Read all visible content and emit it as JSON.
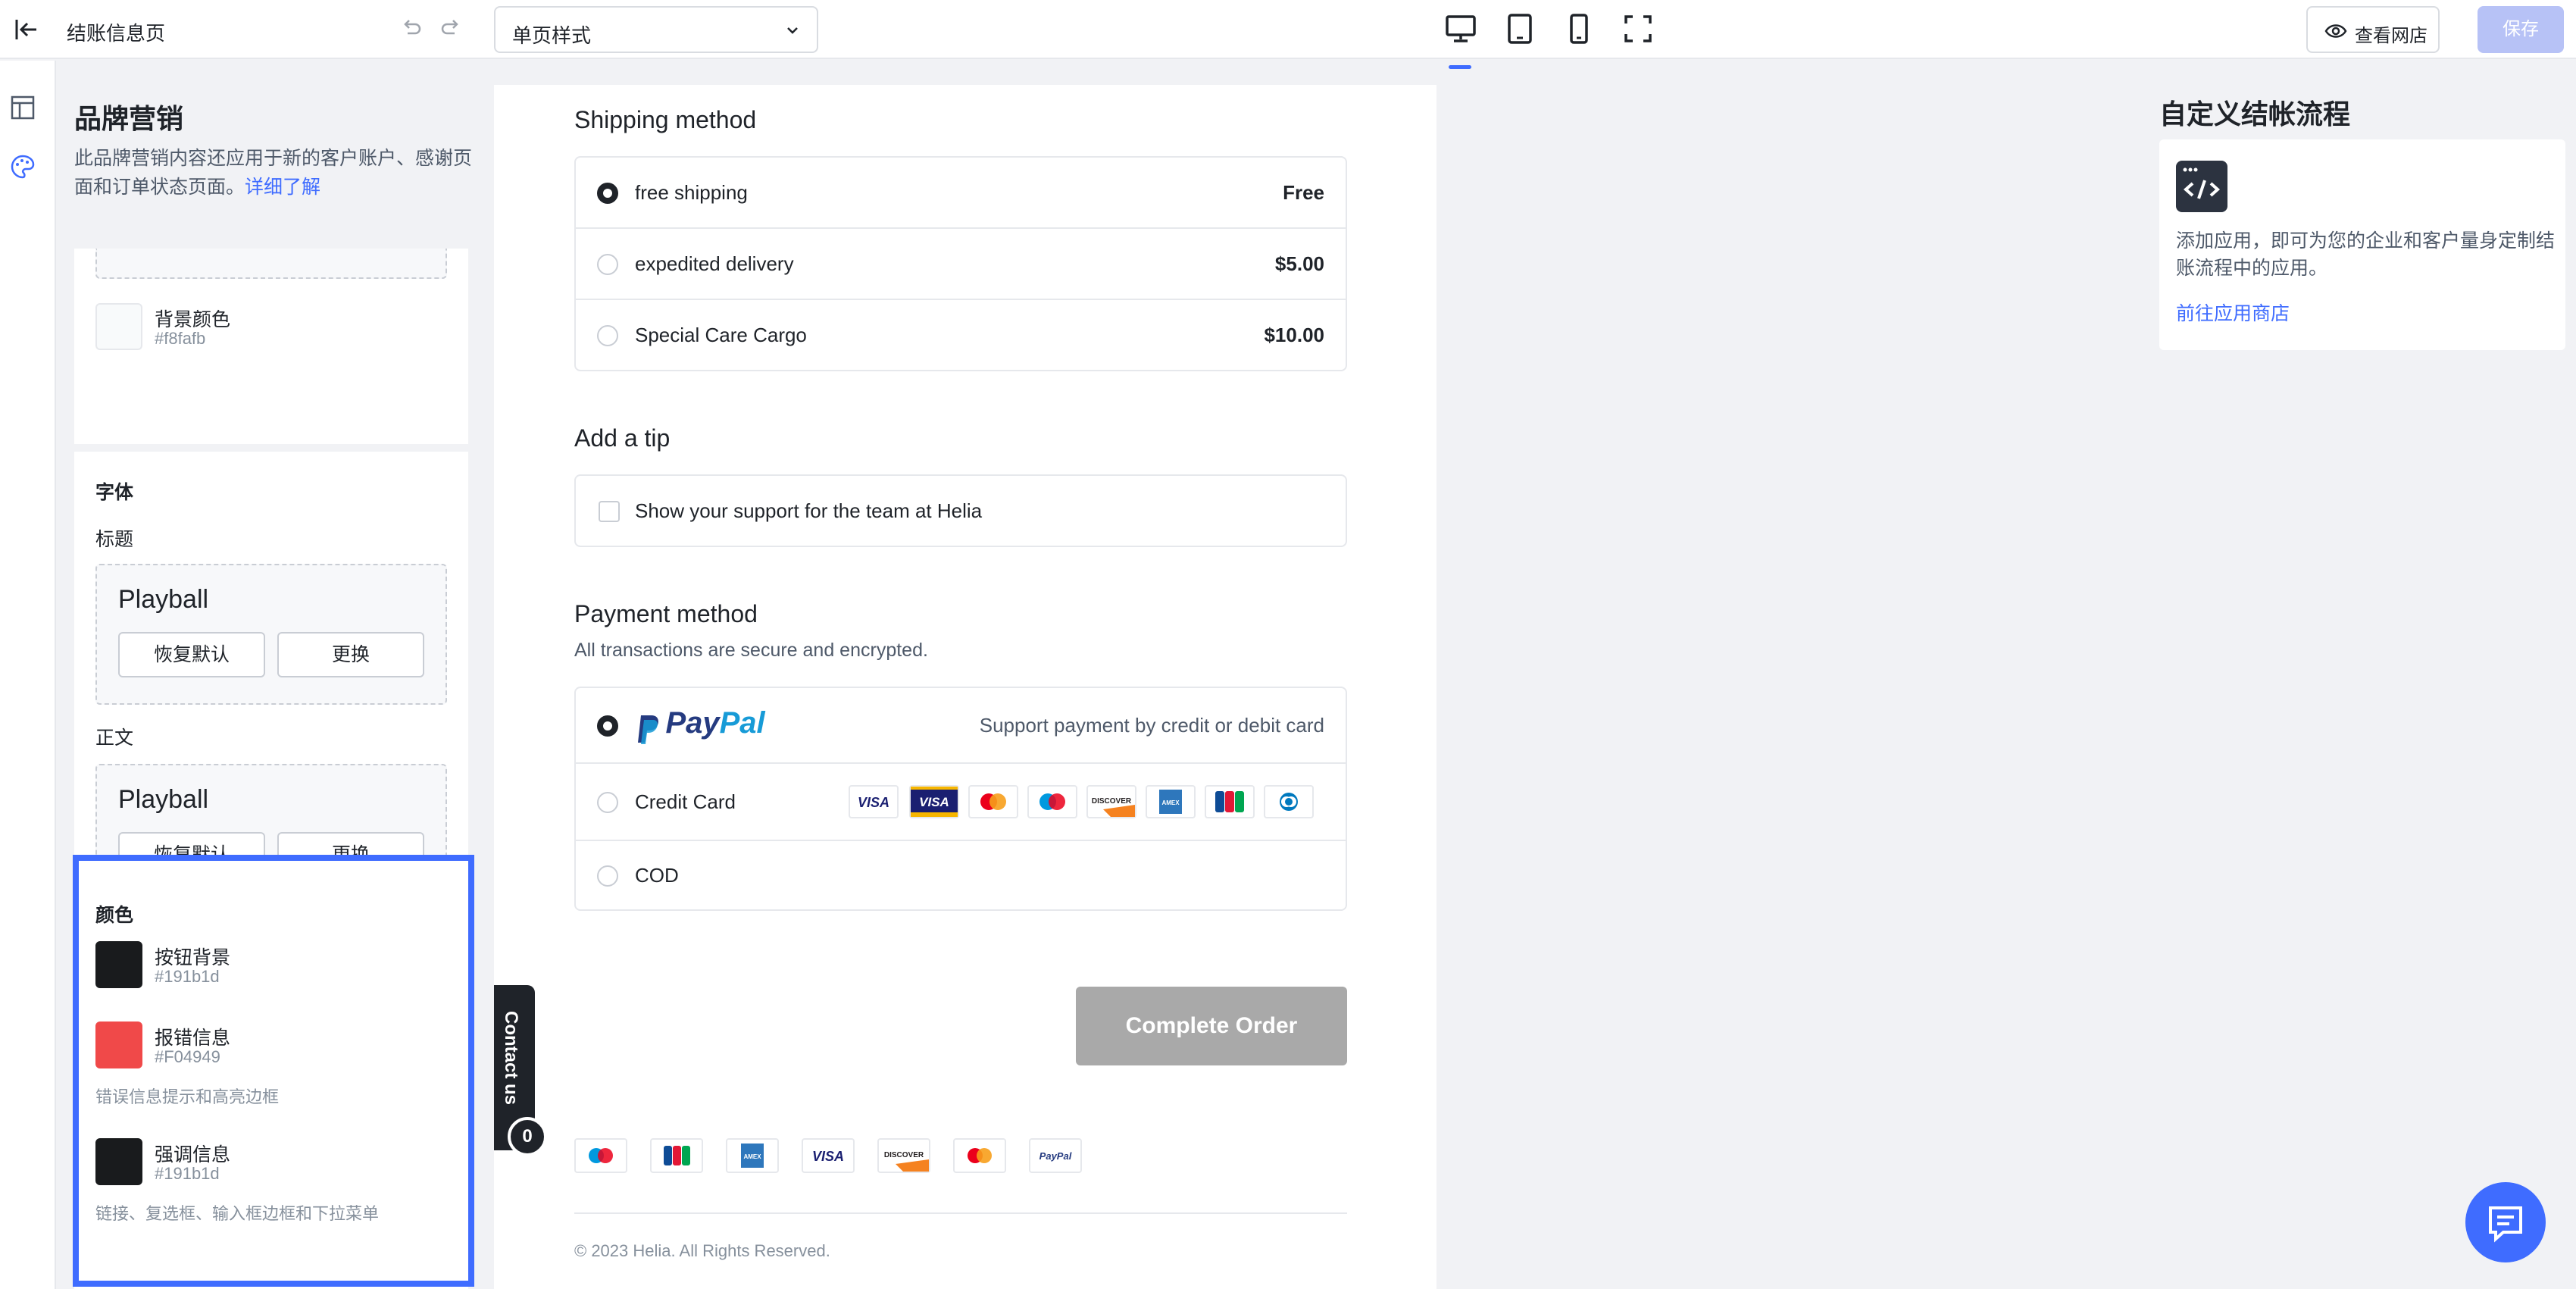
{
  "topbar": {
    "title": "结账信息页",
    "page_style": "单页样式",
    "view_store": "查看网店",
    "save": "保存"
  },
  "brand_panel": {
    "heading": "品牌营销",
    "description": "此品牌营销内容还应用于新的客户账户、感谢页面和订单状态页面。",
    "learn_more": "详细了解",
    "background": {
      "name": "背景颜色",
      "hex": "#f8fafb",
      "color": "#f8fafb"
    },
    "fonts": {
      "section": "字体",
      "heading_label": "标题",
      "heading_font": "Playball",
      "body_label": "正文",
      "body_font": "Playball",
      "reset": "恢复默认",
      "change": "更换"
    },
    "colors": {
      "section": "颜色",
      "items": [
        {
          "name": "按钮背景",
          "hex": "#191b1d",
          "color": "#191b1d",
          "note": ""
        },
        {
          "name": "报错信息",
          "hex": "#F04949",
          "color": "#F04949",
          "note": "错误信息提示和高亮边框"
        },
        {
          "name": "强调信息",
          "hex": "#191b1d",
          "color": "#191b1d",
          "note": "链接、复选框、输入框边框和下拉菜单"
        }
      ]
    }
  },
  "preview": {
    "shipping_title": "Shipping method",
    "shipping_options": [
      {
        "label": "free shipping",
        "price": "Free",
        "selected": true
      },
      {
        "label": "expedited delivery",
        "price": "$5.00",
        "selected": false
      },
      {
        "label": "Special Care Cargo",
        "price": "$10.00",
        "selected": false
      }
    ],
    "tip_title": "Add a tip",
    "tip_option": "Show your support for the team at Helia",
    "payment_title": "Payment method",
    "payment_subtitle": "All transactions are secure and encrypted.",
    "paypal": {
      "logo_pay": "Pay",
      "logo_pal": "Pal",
      "note": "Support payment by credit or debit card"
    },
    "credit_card": "Credit Card",
    "cod": "COD",
    "complete_order": "Complete Order",
    "contact_us": "Contact us",
    "contact_badge": "0",
    "copyright": "© 2023 Helia. All Rights Reserved.",
    "card_icons": [
      "visa",
      "visa-electron",
      "mastercard",
      "maestro",
      "discover",
      "amex",
      "jcb",
      "diners"
    ],
    "footer_icons": [
      "maestro",
      "jcb",
      "amex",
      "visa",
      "discover",
      "mastercard",
      "paypal"
    ]
  },
  "right_panel": {
    "heading": "自定义结帐流程",
    "text": "添加应用，即可为您的企业和客户量身定制结账流程中的应用。",
    "link": "前往应用商店"
  },
  "colors": {
    "accent": "#3f6cff",
    "save_disabled": "#b7c2f6",
    "complete_btn": "#a9a9a9"
  }
}
